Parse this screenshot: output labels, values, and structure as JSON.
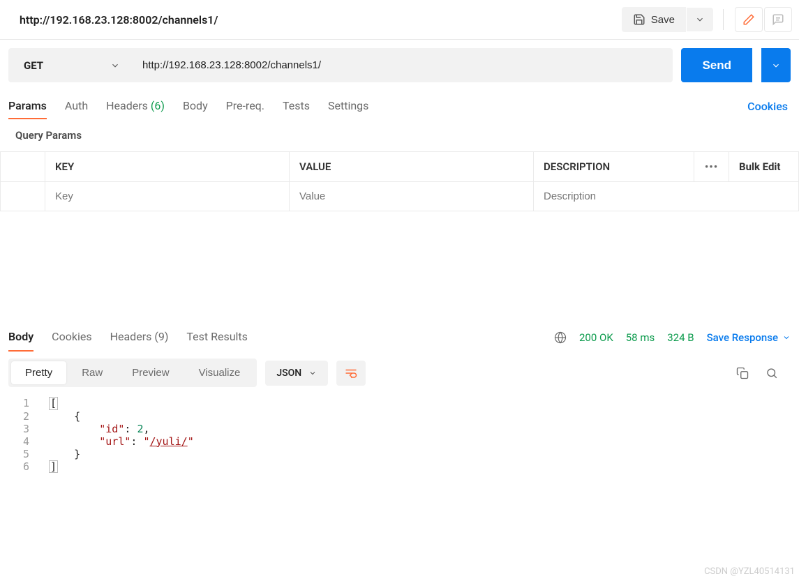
{
  "header": {
    "title": "http://192.168.23.128:8002/channels1/",
    "save_label": "Save"
  },
  "request": {
    "method": "GET",
    "url": "http://192.168.23.128:8002/channels1/",
    "send_label": "Send"
  },
  "reqTabs": {
    "params": "Params",
    "auth": "Auth",
    "headers": "Headers",
    "headers_count": "(6)",
    "body": "Body",
    "prereq": "Pre-req.",
    "tests": "Tests",
    "settings": "Settings",
    "cookies": "Cookies"
  },
  "queryParams": {
    "label": "Query Params",
    "keyHeader": "KEY",
    "valueHeader": "VALUE",
    "descHeader": "DESCRIPTION",
    "bulkEdit": "Bulk Edit",
    "keyPlaceholder": "Key",
    "valuePlaceholder": "Value",
    "descPlaceholder": "Description"
  },
  "respTabs": {
    "body": "Body",
    "cookies": "Cookies",
    "headers": "Headers",
    "headers_count": "(9)",
    "testResults": "Test Results"
  },
  "status": {
    "code": "200 OK",
    "time": "58 ms",
    "size": "324 B",
    "saveResponse": "Save Response"
  },
  "bodyView": {
    "pretty": "Pretty",
    "raw": "Raw",
    "preview": "Preview",
    "visualize": "Visualize",
    "format": "JSON"
  },
  "responseBody": {
    "lines": [
      "1",
      "2",
      "3",
      "4",
      "5",
      "6"
    ],
    "json": [
      {
        "id": 2,
        "url": "/yuli/"
      }
    ]
  },
  "watermark": "CSDN @YZL40514131"
}
